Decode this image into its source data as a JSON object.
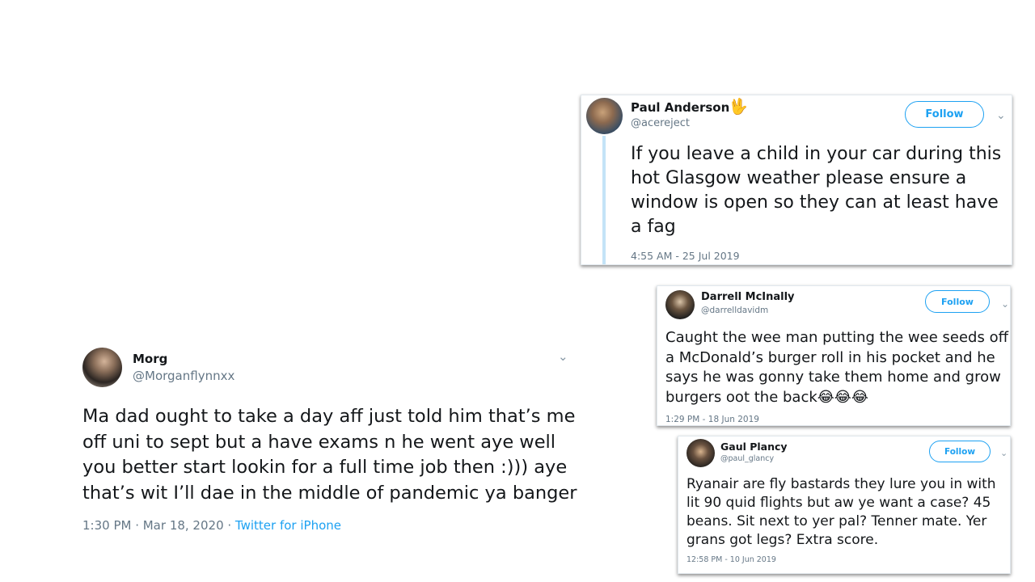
{
  "tweets": {
    "paul": {
      "name": "Paul Anderson",
      "handle": "@acereject",
      "name_emoji": "🖖",
      "follow_label": "Follow",
      "text": "If you leave a child in your car during this hot Glasgow weather please ensure a window is open so they can at least have a fag",
      "time": "4:55 AM - 25 Jul 2019"
    },
    "darrell": {
      "name": "Darrell McInally",
      "handle": "@darrelldavidm",
      "follow_label": "Follow",
      "text": "Caught the wee man putting the wee seeds off a McDonald’s burger roll in his pocket and he says he was gonny take them home and grow burgers oot the back😂😂😂",
      "time": "1:29 PM - 18 Jun 2019"
    },
    "gaul": {
      "name": "Gaul Plancy",
      "handle": "@paul_glancy",
      "follow_label": "Follow",
      "text": "Ryanair are fly bastards they lure you in with lit 90 quid flights but aw ye want a case? 45 beans. Sit next to yer pal? Tenner mate. Yer grans got legs? Extra score.",
      "time": "12:58 PM - 10 Jun 2019"
    },
    "morg": {
      "name": "Morg",
      "handle": "@Morganflynnxx",
      "text": "Ma dad ought to take a day aff just told him that’s me off uni to sept but a have exams n he went aye well you better start lookin for a full time job then :))) aye that’s wit I’ll dae in the middle of pandemic ya banger",
      "time": "1:30 PM · Mar 18, 2020 · ",
      "source": "Twitter for iPhone"
    }
  },
  "icons": {
    "chevron": "chevron-down-icon",
    "avatar": "avatar"
  },
  "colors": {
    "accent": "#1da1f2",
    "muted": "#657786",
    "thread_line": "#c4e3f7"
  }
}
